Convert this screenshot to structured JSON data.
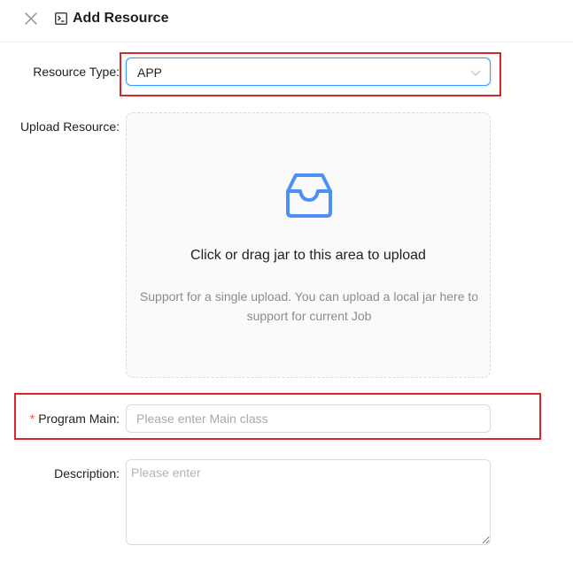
{
  "header": {
    "title": "Add Resource",
    "close_icon": "close-icon",
    "title_icon": "terminal-icon"
  },
  "form": {
    "resource_type": {
      "label": "Resource Type",
      "colon": ":",
      "value": "APP"
    },
    "upload_resource": {
      "label": "Upload Resource",
      "colon": ":",
      "icon": "inbox-icon",
      "title": "Click or drag jar to this area to upload",
      "hint": "Support for a single upload. You can upload a local jar here to support for current Job"
    },
    "program_main": {
      "required_mark": "*",
      "label": "Program Main",
      "colon": ":",
      "placeholder": "Please enter Main class",
      "value": ""
    },
    "description": {
      "label": "Description",
      "colon": ":",
      "placeholder": "Please enter",
      "value": ""
    }
  },
  "colors": {
    "accent": "#4096ff",
    "icon_blue": "#4d90f5",
    "highlight_red": "#d8262f",
    "required_red": "#ff4d4f"
  }
}
